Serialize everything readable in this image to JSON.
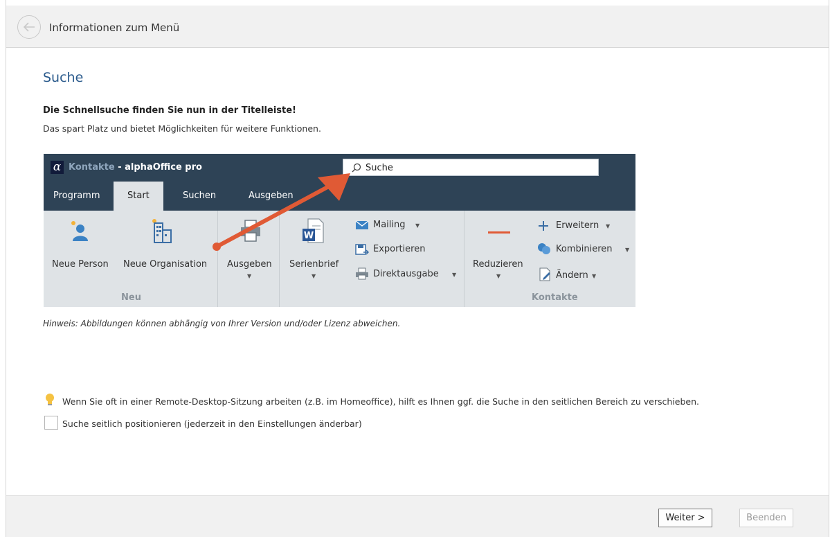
{
  "header": {
    "title": "Informationen zum Menü",
    "back_icon": "arrow-left-icon"
  },
  "main": {
    "section_title": "Suche",
    "lead_bold": "Die Schnellsuche finden Sie nun in der Titelleiste!",
    "lead_text": "Das spart Platz und bietet Möglichkeiten für weitere Funktionen.",
    "hint": "Hinweis: Abbildungen können abhängig von Ihrer Version und/oder Lizenz abweichen.",
    "tip": "Wenn Sie oft in einer Remote-Desktop-Sitzung arbeiten (z.B. im Homeoffice), hilft es Ihnen ggf. die Suche in den seitlichen Bereich zu verschieben.",
    "checkbox": {
      "label": "Suche seitlich positionieren (jederzeit in den Einstellungen änderbar)",
      "checked": false
    }
  },
  "screenshot": {
    "app_module": "Kontakte",
    "app_name": " - alphaOffice pro",
    "search_placeholder": "Suche",
    "tabs": [
      "Programm",
      "Start",
      "Suchen",
      "Ausgeben"
    ],
    "active_tab": "Start",
    "ribbon": {
      "neue_person": "Neue Person",
      "neue_organisation": "Neue Organisation",
      "ausgeben": "Ausgeben",
      "serienbrief": "Serienbrief",
      "mailing": "Mailing",
      "exportieren": "Exportieren",
      "direktausgabe": "Direktausgabe",
      "reduzieren": "Reduzieren",
      "erweitern": "Erweitern",
      "kombinieren": "Kombinieren",
      "aendern": "Ändern",
      "group_neu": "Neu",
      "group_kontakte": "Kontakte"
    }
  },
  "footer": {
    "next_label": "Weiter >",
    "finish_label": "Beenden",
    "finish_enabled": false
  },
  "colors": {
    "accent_title": "#2a5a8c",
    "ribbon_dark": "#2e4356",
    "arrow": "#e05a35"
  }
}
